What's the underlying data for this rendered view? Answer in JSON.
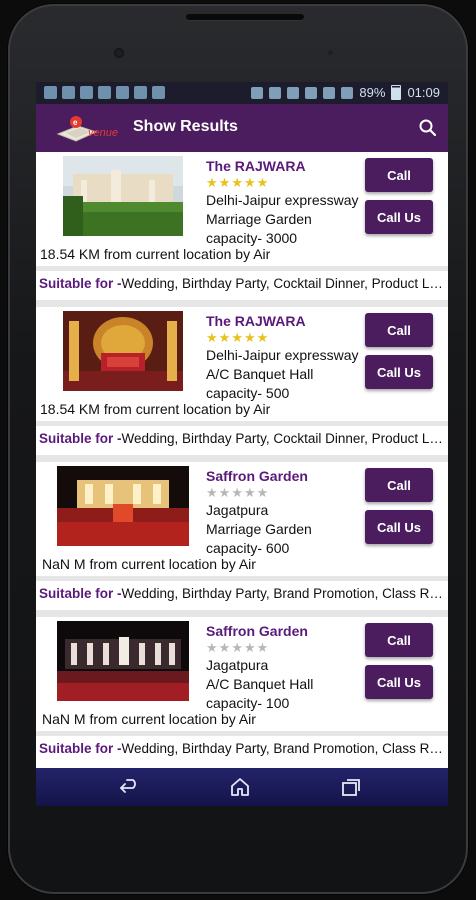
{
  "status_bar": {
    "battery": "89%",
    "time": "01:09",
    "left_icons": [
      "twitter-icon",
      "twitter-icon",
      "app-icon",
      "app-icon",
      "facebook-icon",
      "android-icon",
      "mail-icon"
    ],
    "right_icons": [
      "vibrate-icon",
      "sync-icon",
      "alarm-icon",
      "location-icon",
      "wifi-icon",
      "signal-icon"
    ]
  },
  "app_bar": {
    "title": "Show Results",
    "logo_text": "venue"
  },
  "colors": {
    "primary": "#4b1d5e",
    "star_on": "#e6c21a",
    "star_off": "#b7b7b7",
    "link": "#5a1a7a"
  },
  "venues": [
    {
      "name": "The RAJWARA",
      "rating": 5,
      "address": "Delhi-Jaipur expressway",
      "type": "Marriage Garden",
      "capacity": "capacity- 3000",
      "distance": "18.54 KM from current location by Air",
      "suitable_label": "Suitable for -",
      "suitable_for": "Wedding, Birthday Party, Cocktail Dinner, Product La...",
      "call_label": "Call",
      "call_us_label": "Call Us"
    },
    {
      "name": "The RAJWARA",
      "rating": 5,
      "address": "Delhi-Jaipur expressway",
      "type": "A/C Banquet Hall",
      "capacity": "capacity- 500",
      "distance": "18.54 KM from current location by Air",
      "suitable_label": "Suitable for -",
      "suitable_for": "Wedding, Birthday Party, Cocktail Dinner, Product La...",
      "call_label": "Call",
      "call_us_label": "Call Us"
    },
    {
      "name": "Saffron Garden",
      "rating": 0,
      "address": "Jagatpura",
      "type": "Marriage Garden",
      "capacity": "capacity- 600",
      "distance": "NaN M from current location by Air",
      "suitable_label": "Suitable for -",
      "suitable_for": "Wedding, Birthday Party, Brand Promotion, Class Re...",
      "call_label": "Call",
      "call_us_label": "Call Us"
    },
    {
      "name": "Saffron Garden",
      "rating": 0,
      "address": "Jagatpura",
      "type": "A/C Banquet Hall",
      "capacity": "capacity- 100",
      "distance": "NaN M from current location by Air",
      "suitable_label": "Suitable for -",
      "suitable_for": "Wedding, Birthday Party, Brand Promotion, Class Re...",
      "call_label": "Call",
      "call_us_label": "Call Us"
    }
  ],
  "nav_bar": {
    "icons": [
      "back-icon",
      "home-icon",
      "recent-apps-icon"
    ]
  }
}
